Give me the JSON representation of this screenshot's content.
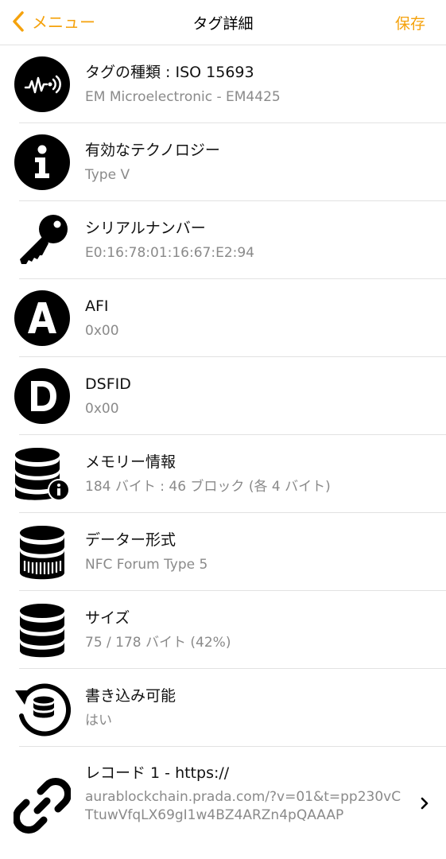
{
  "navbar": {
    "back_label": "メニュー",
    "title": "タグ詳細",
    "save_label": "保存",
    "accent_color": "#f5a20c"
  },
  "rows": [
    {
      "icon": "nfc-signal-icon",
      "label": "タグの種類 : ISO 15693",
      "value": "EM Microelectronic - EM4425"
    },
    {
      "icon": "info-icon",
      "label": "有効なテクノロジー",
      "value": "Type V"
    },
    {
      "icon": "key-icon",
      "label": "シリアルナンバー",
      "value": "E0:16:78:01:16:67:E2:94"
    },
    {
      "icon": "letter-a-icon",
      "label": "AFI",
      "value": "0x00"
    },
    {
      "icon": "letter-d-icon",
      "label": "DSFID",
      "value": "0x00"
    },
    {
      "icon": "database-info-icon",
      "label": "メモリー情報",
      "value": "184 バイト : 46 ブロック (各 4 バイト)"
    },
    {
      "icon": "database-format-icon",
      "label": "データー形式",
      "value": "NFC Forum Type 5"
    },
    {
      "icon": "database-size-icon",
      "label": "サイズ",
      "value": "75 / 178 バイト (42%)"
    },
    {
      "icon": "database-writable-icon",
      "label": "書き込み可能",
      "value": "はい"
    },
    {
      "icon": "link-icon",
      "label": "レコード 1 - https://",
      "value": "aurablockchain.prada.com/?v=01&t=pp230vCTtuwVfqLX69gI1w4BZ4ARZn4pQAAAP"
    }
  ]
}
